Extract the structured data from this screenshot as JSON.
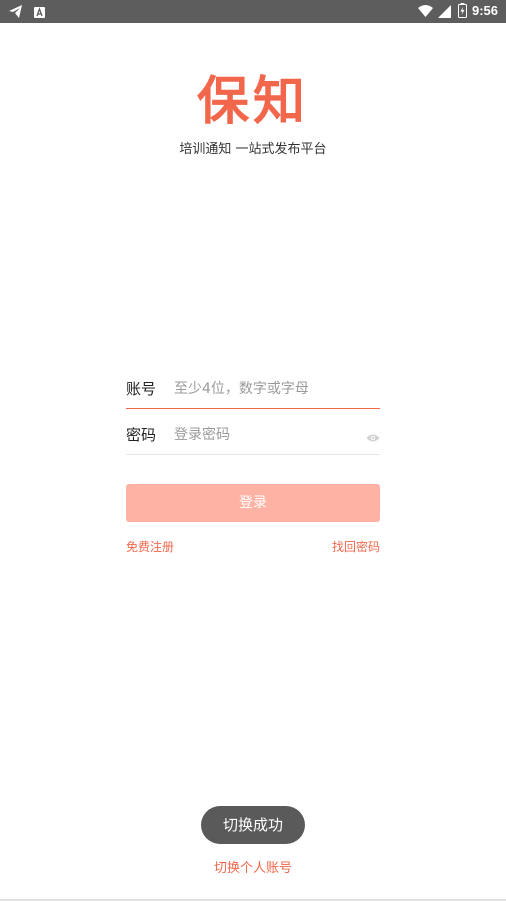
{
  "status_bar": {
    "time": "9:56",
    "left_icons": [
      "telegram-icon",
      "app-notification-icon"
    ],
    "right_icons": [
      "wifi-icon",
      "signal-icon",
      "battery-icon"
    ]
  },
  "brand": {
    "logo_text": "保知",
    "tagline": "培训通知 一站式发布平台",
    "accent_color": "#f2674b"
  },
  "form": {
    "account_label": "账号",
    "account_placeholder": "至少4位，数字或字母",
    "account_value": "",
    "password_label": "密码",
    "password_placeholder": "登录密码",
    "password_value": "",
    "login_label": "登录"
  },
  "links": {
    "register": "免费注册",
    "forgot_password": "找回密码",
    "switch_account": "切换个人账号"
  },
  "toast": {
    "message": "切换成功"
  }
}
